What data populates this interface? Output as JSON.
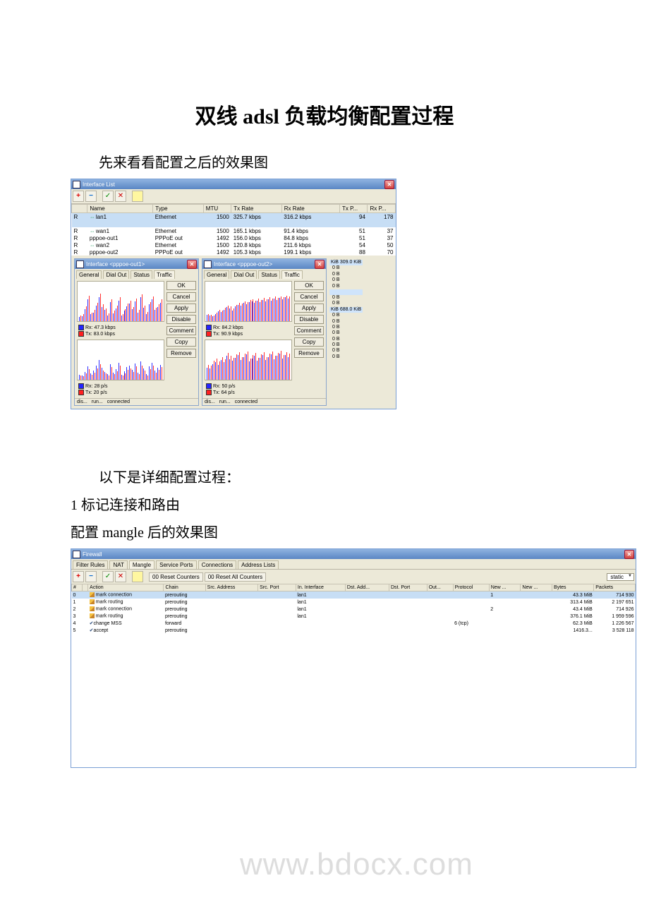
{
  "doc": {
    "title": "双线 adsl 负载均衡配置过程",
    "intro": "先来看看配置之后的效果图",
    "mid1": "以下是详细配置过程：",
    "mid2": "1 标记连接和路由",
    "mid3": "配置 mangle 后的效果图",
    "watermark": "www.bdocx.com"
  },
  "iface_win": {
    "title": "Interface List",
    "toolbar": {
      "add": "+",
      "remove": "−",
      "enable": "✓",
      "disable": "✕"
    },
    "columns": [
      "",
      "Name",
      "Type",
      "MTU",
      "Tx Rate",
      "Rx Rate",
      "Tx P...",
      "Rx P..."
    ],
    "rows": [
      {
        "flag": "R",
        "name": "lan1",
        "type": "Ethernet",
        "mtu": "1500",
        "tx": "325.7 kbps",
        "rx": "316.2 kbps",
        "txp": "94",
        "rxp": "178",
        "sel": true,
        "arrow": true
      },
      {
        "flag": "",
        "name": "",
        "type": "",
        "mtu": "",
        "tx": "",
        "rx": "",
        "txp": "",
        "rxp": "",
        "sel": true
      },
      {
        "flag": "R",
        "name": "wan1",
        "type": "Ethernet",
        "mtu": "1500",
        "tx": "165.1 kbps",
        "rx": "91.4 kbps",
        "txp": "51",
        "rxp": "37",
        "arrow": true
      },
      {
        "flag": "R",
        "name": "pppoe-out1",
        "type": "PPPoE out",
        "mtu": "1492",
        "tx": "156.0 kbps",
        "rx": "84.8 kbps",
        "txp": "51",
        "rxp": "37"
      },
      {
        "flag": "R",
        "name": "wan2",
        "type": "Ethernet",
        "mtu": "1500",
        "tx": "120.8 kbps",
        "rx": "211.6 kbps",
        "txp": "54",
        "rxp": "50",
        "arrow": true
      },
      {
        "flag": "R",
        "name": "pppoe-out2",
        "type": "PPPoE out",
        "mtu": "1492",
        "tx": "105.3 kbps",
        "rx": "199.1 kbps",
        "txp": "88",
        "rxp": "70"
      }
    ]
  },
  "sub": {
    "win1": {
      "title": "Interface <pppoe-out1>",
      "tabs": [
        "General",
        "Dial Out",
        "Status",
        "Traffic"
      ],
      "active_tab": 3,
      "buttons": [
        "OK",
        "Cancel",
        "Apply",
        "Disable",
        "Comment",
        "Copy",
        "Remove"
      ],
      "legend1": {
        "rx": "Rx: 47.3 kbps",
        "tx": "Tx: 83.0 kbps"
      },
      "legend2": {
        "rx": "Rx: 28 p/s",
        "tx": "Tx: 20 p/s"
      },
      "status": [
        "dis...",
        "run...",
        "connected"
      ]
    },
    "win2": {
      "title": "Interface <pppoe-out2>",
      "tabs": [
        "General",
        "Dial Out",
        "Status",
        "Traffic"
      ],
      "active_tab": 3,
      "buttons": [
        "OK",
        "Cancel",
        "Apply",
        "Disable",
        "Comment",
        "Copy",
        "Remove"
      ],
      "legend1": {
        "rx": "Rx: 84.2 kbps",
        "tx": "Tx: 90.9 kbps"
      },
      "legend2": {
        "rx": "Rx: 50 p/s",
        "tx": "Tx: 64 p/s"
      },
      "status": [
        "dis...",
        "run...",
        "connected"
      ]
    },
    "side": {
      "hdr1": "KiB 309.0 KiB",
      "lines1": [
        "0 B",
        "0 B",
        "0 B",
        "0 B"
      ],
      "hdr2": "",
      "lines2": [
        "0 B",
        "0 B"
      ],
      "hdr3": "KiB 688.0 KiB",
      "lines3": [
        "0 B",
        "0 B",
        "0 B",
        "0 B",
        "0 B",
        "0 B",
        "0 B",
        "0 B"
      ]
    }
  },
  "firewall": {
    "title": "Firewall",
    "tabs": [
      "Filter Rules",
      "NAT",
      "Mangle",
      "Service Ports",
      "Connections",
      "Address Lists"
    ],
    "active_tab": 2,
    "toolbar": {
      "reset": "00 Reset Counters",
      "reset_all": "00 Reset All Counters",
      "select": "static"
    },
    "columns": [
      "#",
      "",
      "Action",
      "Chain",
      "Src. Address",
      "Src. Port",
      "In. Interface",
      "Dst. Add...",
      "Dst. Port",
      "Out...",
      "Protocol",
      "New ...",
      "New ...",
      "Bytes",
      "Packets"
    ],
    "rows": [
      {
        "sel": true,
        "icon": "pencil",
        "action": "mark connection",
        "chain": "prerouting",
        "in": "lan1",
        "new": "1",
        "bytes": "43.3 MiB",
        "packets": "714 930"
      },
      {
        "icon": "pencil",
        "action": "mark routing",
        "chain": "prerouting",
        "in": "lan1",
        "bytes": "313.4 MiB",
        "packets": "2 197 651"
      },
      {
        "icon": "pencil",
        "action": "mark connection",
        "chain": "prerouting",
        "in": "lan1",
        "new": "2",
        "bytes": "43.4 MiB",
        "packets": "714 926"
      },
      {
        "icon": "pencil",
        "action": "mark routing",
        "chain": "prerouting",
        "in": "lan1",
        "bytes": "376.1 MiB",
        "packets": "1 959 596"
      },
      {
        "icon": "check",
        "action": "change MSS",
        "chain": "forward",
        "proto": "6 (tcp)",
        "bytes": "62.3 MiB",
        "packets": "1 226 567"
      },
      {
        "icon": "check",
        "action": "accept",
        "chain": "prerouting",
        "bytes": "1416.3...",
        "packets": "3 528 118"
      }
    ]
  },
  "chart_data": [
    {
      "type": "bar",
      "title": "pppoe-out1 traffic (kbps)",
      "series": [
        {
          "name": "Rx",
          "values": [
            10,
            12,
            30,
            55,
            18,
            22,
            40,
            60,
            35,
            28,
            15,
            48,
            20,
            33,
            52,
            14,
            26,
            38,
            44,
            30,
            50,
            22,
            60,
            34,
            18,
            42,
            55,
            28,
            36,
            47
          ]
        },
        {
          "name": "Tx",
          "values": [
            15,
            18,
            38,
            65,
            22,
            28,
            46,
            70,
            42,
            33,
            20,
            55,
            26,
            40,
            60,
            18,
            30,
            45,
            52,
            36,
            58,
            28,
            68,
            40,
            24,
            48,
            62,
            34,
            42,
            55
          ]
        }
      ],
      "xlabel": "",
      "ylabel": "kbps",
      "ylim": [
        0,
        100
      ]
    },
    {
      "type": "bar",
      "title": "pppoe-out1 traffic (p/s)",
      "series": [
        {
          "name": "Rx",
          "values": [
            8,
            6,
            12,
            20,
            10,
            14,
            22,
            30,
            18,
            12,
            9,
            24,
            11,
            16,
            26,
            8,
            13,
            19,
            21,
            15,
            25,
            11,
            28,
            17,
            9,
            20,
            26,
            14,
            18,
            23
          ]
        },
        {
          "name": "Tx",
          "values": [
            6,
            5,
            10,
            16,
            8,
            11,
            17,
            24,
            14,
            10,
            7,
            19,
            9,
            13,
            21,
            6,
            10,
            15,
            17,
            12,
            20,
            9,
            22,
            14,
            7,
            16,
            21,
            11,
            15,
            19
          ]
        }
      ],
      "xlabel": "",
      "ylabel": "p/s",
      "ylim": [
        0,
        60
      ]
    },
    {
      "type": "bar",
      "title": "pppoe-out2 traffic (kbps)",
      "series": [
        {
          "name": "Rx",
          "values": [
            20,
            18,
            15,
            22,
            30,
            28,
            35,
            42,
            38,
            32,
            45,
            50,
            48,
            55,
            52,
            58,
            60,
            56,
            62,
            58,
            64,
            60,
            66,
            62,
            68,
            64,
            70,
            66,
            72,
            68
          ]
        },
        {
          "name": "Tx",
          "values": [
            22,
            20,
            18,
            26,
            34,
            32,
            40,
            48,
            44,
            38,
            50,
            56,
            54,
            60,
            58,
            64,
            66,
            62,
            68,
            64,
            70,
            66,
            72,
            68,
            74,
            70,
            76,
            72,
            78,
            74
          ]
        }
      ],
      "xlabel": "",
      "ylabel": "kbps",
      "ylim": [
        0,
        120
      ]
    },
    {
      "type": "bar",
      "title": "pppoe-out2 traffic (p/s)",
      "series": [
        {
          "name": "Rx",
          "values": [
            30,
            28,
            40,
            45,
            38,
            50,
            44,
            60,
            52,
            48,
            55,
            62,
            50,
            58,
            64,
            46,
            54,
            60,
            48,
            56,
            62,
            50,
            58,
            64,
            52,
            60,
            66,
            54,
            62,
            58
          ]
        },
        {
          "name": "Tx",
          "values": [
            38,
            36,
            48,
            54,
            46,
            58,
            52,
            68,
            60,
            56,
            64,
            70,
            58,
            66,
            72,
            54,
            62,
            68,
            56,
            64,
            70,
            58,
            66,
            72,
            60,
            68,
            74,
            62,
            70,
            66
          ]
        }
      ],
      "xlabel": "",
      "ylabel": "p/s",
      "ylim": [
        0,
        100
      ]
    }
  ]
}
